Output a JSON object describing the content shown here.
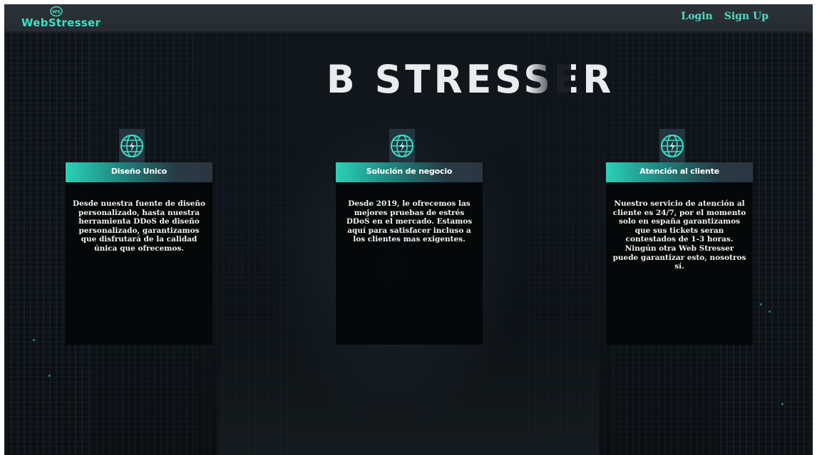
{
  "header": {
    "logo_text": "WebStresser",
    "logo_badge": "WS",
    "nav": [
      {
        "label": "Login"
      },
      {
        "label": "Sign Up"
      }
    ]
  },
  "hero": {
    "title": "B STRESSER"
  },
  "features": [
    {
      "title": "Diseño Unico",
      "icon": "globe-bolt-icon",
      "text": "Desde nuestra fuente de diseño personalizado, hasta nuestra herramienta DDoS de diseño personalizado, garantizamos que disfrutará de la calidad única que ofrecemos."
    },
    {
      "title": "Solución de negocio",
      "icon": "globe-bolt-icon",
      "text": "Desde 2019, le ofrecemos las mejores pruebas de estrés DDoS en el mercado. Estamos aquí para satisfacer incluso a los clientes mas exigentes."
    },
    {
      "title": "Atención al cliente",
      "icon": "globe-bolt-icon",
      "text": "Nuestro servicio de atención al cliente es 24/7, por el momento solo en españa garantizamos que sus tickets seran contestados de 1-3 horas. Ningún otra Web Stresser puede garantizar esto, nosotros sí."
    }
  ],
  "colors": {
    "accent": "#3fe0c5",
    "nav_link": "#4fdcc2",
    "header_bg": "#2b3238",
    "card_bg": "#040608",
    "banner_start": "#2bd1b6"
  }
}
